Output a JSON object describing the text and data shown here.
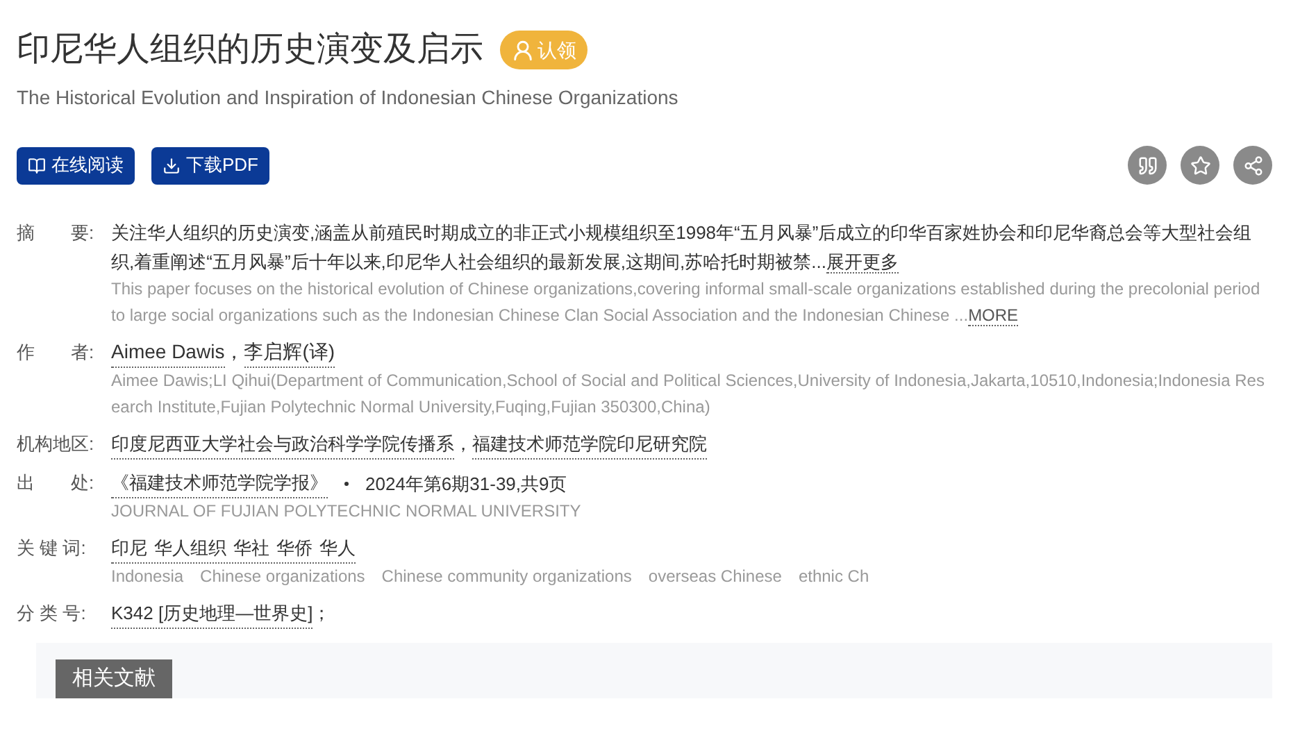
{
  "title": "印尼华人组织的历史演变及启示",
  "claim_badge": "认领",
  "subtitle": "The Historical Evolution and Inspiration of Indonesian Chinese Organizations",
  "actions": [
    {
      "kind": "read",
      "label": "在线阅读"
    },
    {
      "kind": "download",
      "label": "下载PDF"
    }
  ],
  "tools": [
    {
      "kind": "cite"
    },
    {
      "kind": "favorite"
    },
    {
      "kind": "share"
    }
  ],
  "abstract": {
    "label": "摘　　要:",
    "text": "关注华人组织的历史演变,涵盖从前殖民时期成立的非正式小规模组织至1998年“五月风暴”后成立的印华百家姓协会和印尼华裔总会等大型社会组织,着重阐述“五月风暴”后十年以来,印尼华人社会组织的最新发展,这期间,苏哈托时期被禁...",
    "more": "展开更多",
    "english": "This paper focuses on the historical evolution of Chinese organizations,covering informal small-scale organizations established during the precolonial period to large social organizations such as the Indonesian Chinese Clan Social Association and the Indonesian Chinese ...",
    "english_more": "MORE"
  },
  "authors": {
    "label": "作　　者:",
    "names": [
      "Aimee Dawis",
      "李启辉(译)"
    ],
    "separator": "，",
    "english": "Aimee Dawis;LI Qihui(Department of Communication,School of Social and Political Sciences,University of Indonesia,Jakarta,10510,Indonesia;Indonesia Research Institute,Fujian Polytechnic Normal University,Fuqing,Fujian 350300,China)"
  },
  "institutions": {
    "label": "机构地区:",
    "names": [
      "印度尼西亚大学社会与政治科学学院传播系",
      "福建技术师范学院印尼研究院"
    ],
    "separator": "，"
  },
  "source": {
    "label": "出　　处:",
    "journal": "《福建技术师范学院学报》",
    "issue": "2024年第6期31-39,共9页",
    "english": "JOURNAL OF FUJIAN POLYTECHNIC NORMAL UNIVERSITY"
  },
  "keywords": {
    "label": "关 键 词:",
    "chinese": [
      "印尼",
      "华人组织",
      "华社",
      "华侨",
      "华人"
    ],
    "english": [
      "Indonesia",
      "Chinese organizations",
      "Chinese community organizations",
      "overseas Chinese",
      "ethnic Ch"
    ]
  },
  "classification": {
    "label": "分 类 号:",
    "code": "K342 [历史地理—世界史]",
    "suffix": "；"
  },
  "related_tab": "相关文献"
}
